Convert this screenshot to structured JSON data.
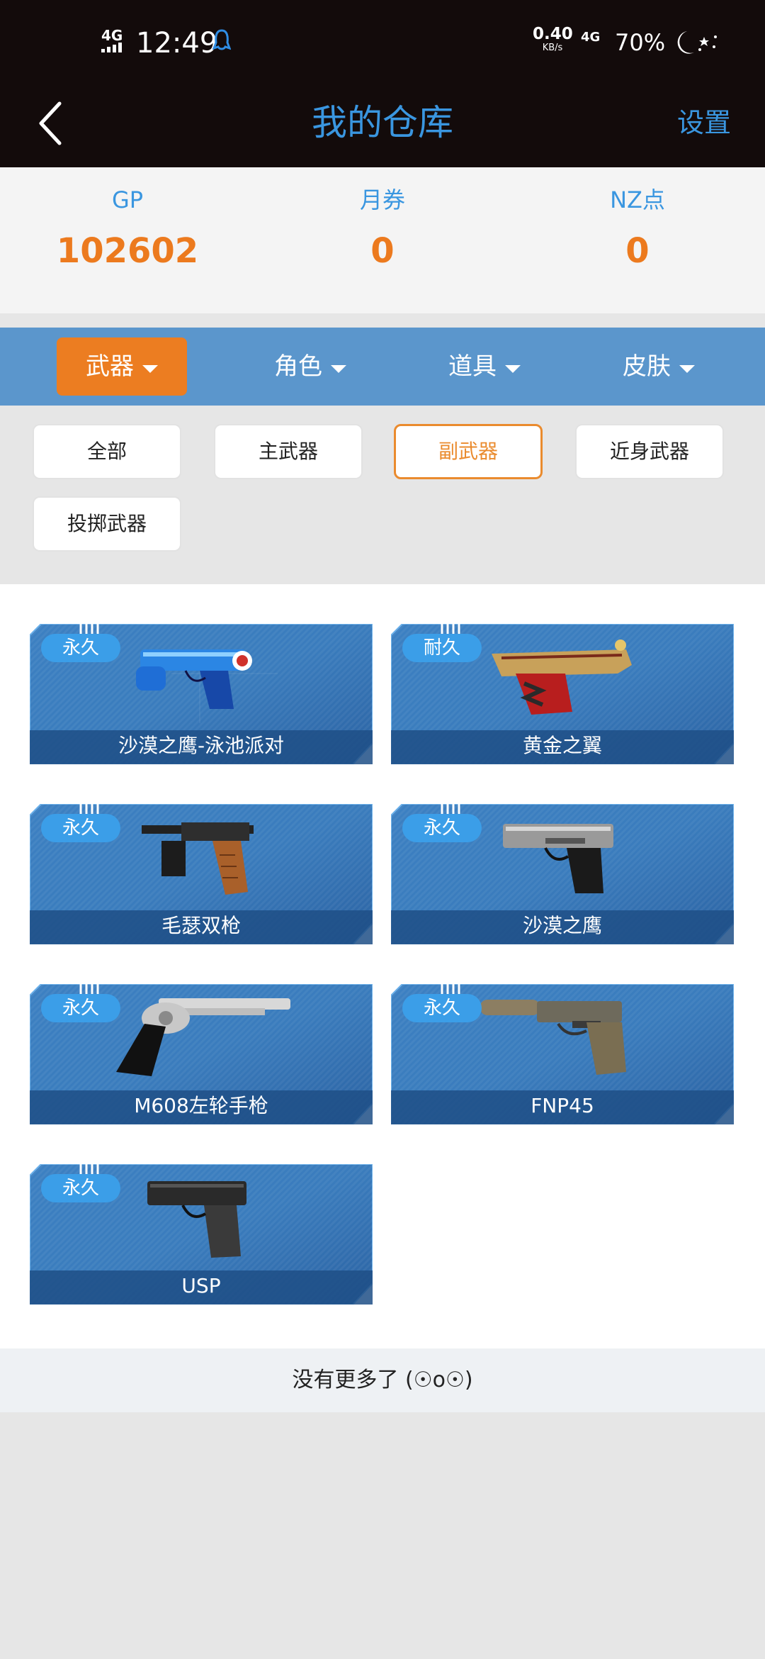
{
  "status_bar": {
    "network": "4G",
    "network2": "4G",
    "time": "12:49",
    "speed_value": "0.40",
    "speed_unit": "KB/s",
    "battery": "70%"
  },
  "header": {
    "title": "我的仓库",
    "settings_label": "设置"
  },
  "currency": [
    {
      "label": "GP",
      "value": "102602"
    },
    {
      "label": "月券",
      "value": "0"
    },
    {
      "label": "NZ点",
      "value": "0"
    }
  ],
  "categories": [
    {
      "label": "武器",
      "active": true
    },
    {
      "label": "角色",
      "active": false
    },
    {
      "label": "道具",
      "active": false
    },
    {
      "label": "皮肤",
      "active": false
    }
  ],
  "filters": [
    {
      "label": "全部",
      "active": false
    },
    {
      "label": "主武器",
      "active": false
    },
    {
      "label": "副武器",
      "active": true
    },
    {
      "label": "近身武器",
      "active": false
    },
    {
      "label": "投掷武器",
      "active": false
    }
  ],
  "items": [
    {
      "tag": "永久",
      "name": "沙漠之鹰-泳池派对",
      "icon": "blue-pistol-icon"
    },
    {
      "tag": "耐久",
      "name": "黄金之翼",
      "icon": "gold-pistol-icon"
    },
    {
      "tag": "永久",
      "name": "毛瑟双枪",
      "icon": "mauser-pistol-icon"
    },
    {
      "tag": "永久",
      "name": "沙漠之鹰",
      "icon": "desert-eagle-icon"
    },
    {
      "tag": "永久",
      "name": "M608左轮手枪",
      "icon": "revolver-icon"
    },
    {
      "tag": "永久",
      "name": "FNP45",
      "icon": "fnp45-pistol-icon"
    },
    {
      "tag": "永久",
      "name": "USP",
      "icon": "usp-pistol-icon"
    }
  ],
  "end_text": "没有更多了 (☉o☉)",
  "colors": {
    "accent_blue": "#3a96e0",
    "accent_orange": "#ec7a1e",
    "category_bar": "#5b96cc",
    "card_blue": "#2f6fb0"
  }
}
